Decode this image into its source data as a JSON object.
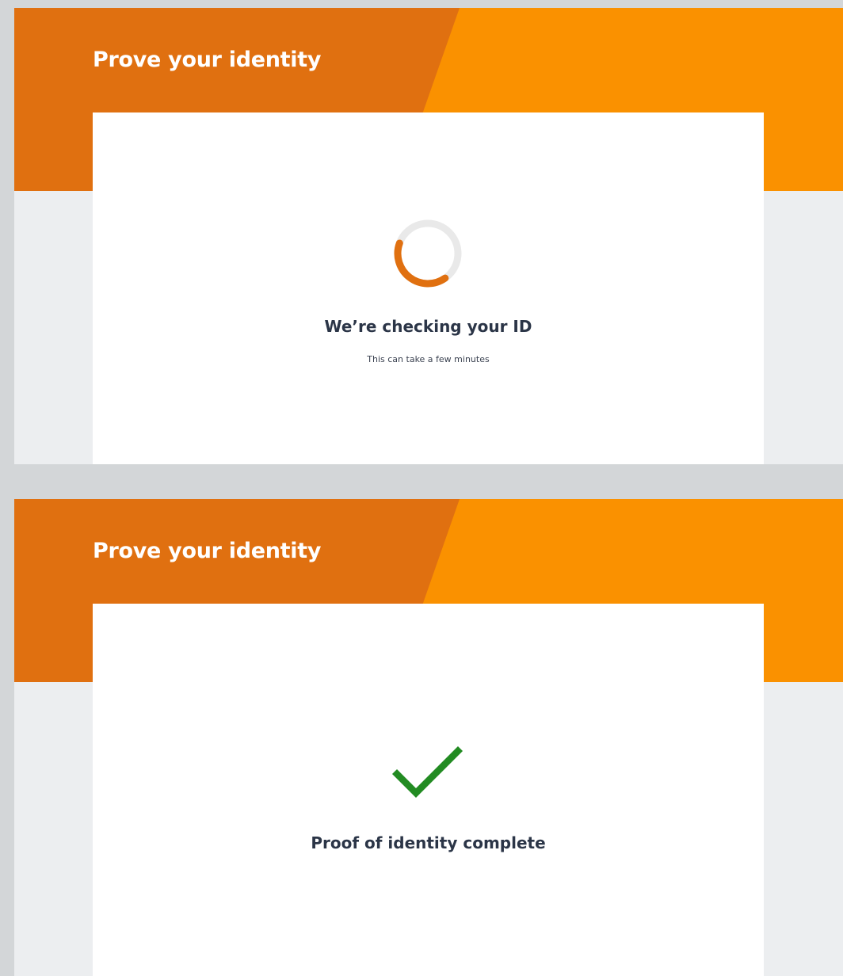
{
  "colors": {
    "banner_dark": "#e07010",
    "banner_light": "#fa9100",
    "page_background": "#eceef0",
    "card_background": "#ffffff",
    "spinner_track": "#e9e9e9",
    "spinner_arc": "#e07010",
    "heading_text": "#2b3547",
    "success_green": "#228b22"
  },
  "screens": [
    {
      "page_title": "Prove your identity",
      "status_icon": "loading-spinner-icon",
      "status_title": "We’re checking your ID",
      "status_subtitle": "This can take a few minutes"
    },
    {
      "page_title": "Prove your identity",
      "status_icon": "checkmark-icon",
      "status_title": "Proof of identity complete"
    }
  ]
}
